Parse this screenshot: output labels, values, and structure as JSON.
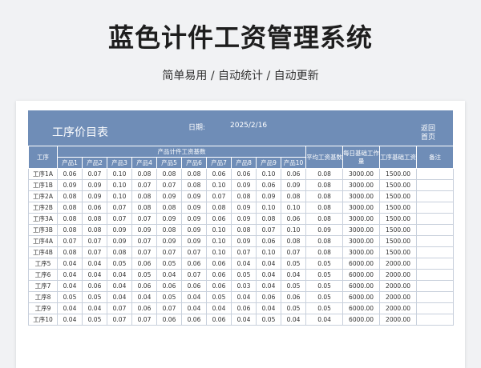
{
  "hero": {
    "title": "蓝色计件工资管理系统",
    "subtitle": "简单易用  /  自动统计  /  自动更新"
  },
  "banner": {
    "title": "工序价目表",
    "date_label": "日期:",
    "date_value": "2025/2/16",
    "back_label": "返回首页"
  },
  "table": {
    "col_process": "工序",
    "group_header": "产品计件工资基数",
    "product_headers": [
      "产品1",
      "产品2",
      "产品3",
      "产品4",
      "产品5",
      "产品6",
      "产品7",
      "产品8",
      "产品9",
      "产品10"
    ],
    "col_avg": "平均工资基数",
    "col_daily": "每日基础工作量",
    "col_base": "工序基础工资",
    "col_note": "备注",
    "rows": [
      {
        "name": "工序1A",
        "vals": [
          "0.06",
          "0.07",
          "0.10",
          "0.08",
          "0.08",
          "0.08",
          "0.06",
          "0.06",
          "0.10",
          "0.06"
        ],
        "avg": "0.08",
        "daily": "3000.00",
        "base": "1500.00",
        "note": ""
      },
      {
        "name": "工序1B",
        "vals": [
          "0.09",
          "0.09",
          "0.10",
          "0.07",
          "0.07",
          "0.08",
          "0.10",
          "0.09",
          "0.06",
          "0.09"
        ],
        "avg": "0.08",
        "daily": "3000.00",
        "base": "1500.00",
        "note": ""
      },
      {
        "name": "工序2A",
        "vals": [
          "0.08",
          "0.09",
          "0.10",
          "0.08",
          "0.09",
          "0.09",
          "0.07",
          "0.08",
          "0.09",
          "0.08"
        ],
        "avg": "0.08",
        "daily": "3000.00",
        "base": "1500.00",
        "note": ""
      },
      {
        "name": "工序2B",
        "vals": [
          "0.08",
          "0.06",
          "0.07",
          "0.08",
          "0.08",
          "0.09",
          "0.08",
          "0.09",
          "0.10",
          "0.10"
        ],
        "avg": "0.08",
        "daily": "3000.00",
        "base": "1500.00",
        "note": ""
      },
      {
        "name": "工序3A",
        "vals": [
          "0.08",
          "0.08",
          "0.07",
          "0.07",
          "0.09",
          "0.09",
          "0.06",
          "0.09",
          "0.08",
          "0.06"
        ],
        "avg": "0.08",
        "daily": "3000.00",
        "base": "1500.00",
        "note": ""
      },
      {
        "name": "工序3B",
        "vals": [
          "0.08",
          "0.08",
          "0.09",
          "0.09",
          "0.08",
          "0.09",
          "0.10",
          "0.08",
          "0.07",
          "0.10"
        ],
        "avg": "0.09",
        "daily": "3000.00",
        "base": "1500.00",
        "note": ""
      },
      {
        "name": "工序4A",
        "vals": [
          "0.07",
          "0.07",
          "0.09",
          "0.07",
          "0.09",
          "0.09",
          "0.10",
          "0.09",
          "0.06",
          "0.08"
        ],
        "avg": "0.08",
        "daily": "3000.00",
        "base": "1500.00",
        "note": ""
      },
      {
        "name": "工序4B",
        "vals": [
          "0.08",
          "0.07",
          "0.08",
          "0.07",
          "0.07",
          "0.07",
          "0.10",
          "0.07",
          "0.10",
          "0.07"
        ],
        "avg": "0.08",
        "daily": "3000.00",
        "base": "1500.00",
        "note": ""
      },
      {
        "name": "工序5",
        "vals": [
          "0.04",
          "0.04",
          "0.05",
          "0.06",
          "0.05",
          "0.06",
          "0.06",
          "0.04",
          "0.04",
          "0.05"
        ],
        "avg": "0.05",
        "daily": "6000.00",
        "base": "2000.00",
        "note": ""
      },
      {
        "name": "工序6",
        "vals": [
          "0.04",
          "0.04",
          "0.04",
          "0.05",
          "0.04",
          "0.07",
          "0.06",
          "0.05",
          "0.04",
          "0.04"
        ],
        "avg": "0.05",
        "daily": "6000.00",
        "base": "2000.00",
        "note": ""
      },
      {
        "name": "工序7",
        "vals": [
          "0.04",
          "0.06",
          "0.04",
          "0.06",
          "0.06",
          "0.06",
          "0.06",
          "0.03",
          "0.04",
          "0.05"
        ],
        "avg": "0.05",
        "daily": "6000.00",
        "base": "2000.00",
        "note": ""
      },
      {
        "name": "工序8",
        "vals": [
          "0.05",
          "0.05",
          "0.04",
          "0.04",
          "0.05",
          "0.04",
          "0.05",
          "0.04",
          "0.06",
          "0.06"
        ],
        "avg": "0.05",
        "daily": "6000.00",
        "base": "2000.00",
        "note": ""
      },
      {
        "name": "工序9",
        "vals": [
          "0.04",
          "0.04",
          "0.07",
          "0.06",
          "0.07",
          "0.04",
          "0.04",
          "0.06",
          "0.04",
          "0.05"
        ],
        "avg": "0.05",
        "daily": "6000.00",
        "base": "2000.00",
        "note": ""
      },
      {
        "name": "工序10",
        "vals": [
          "0.04",
          "0.05",
          "0.07",
          "0.07",
          "0.06",
          "0.06",
          "0.06",
          "0.04",
          "0.05",
          "0.04"
        ],
        "avg": "0.04",
        "daily": "6000.00",
        "base": "2000.00",
        "note": ""
      }
    ]
  }
}
